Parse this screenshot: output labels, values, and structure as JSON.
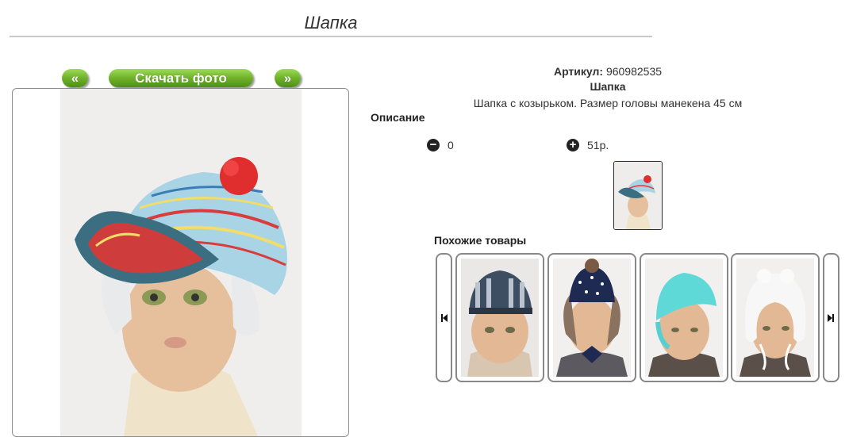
{
  "page": {
    "title": "Шапка"
  },
  "photo_nav": {
    "prev_label": "«",
    "download_label": "Скачать фото",
    "next_label": "»"
  },
  "product": {
    "article_label": "Артикул:",
    "article_value": "960982535",
    "name": "Шапка",
    "short_desc": "Шапка с козырьком. Размер головы манекена 45 см",
    "description_label": "Описание",
    "qty_value": "0",
    "price": "51р."
  },
  "similar": {
    "title": "Похожие товары",
    "count": 4
  },
  "colors": {
    "button_green": "#6fb22a",
    "border": "#888888"
  }
}
